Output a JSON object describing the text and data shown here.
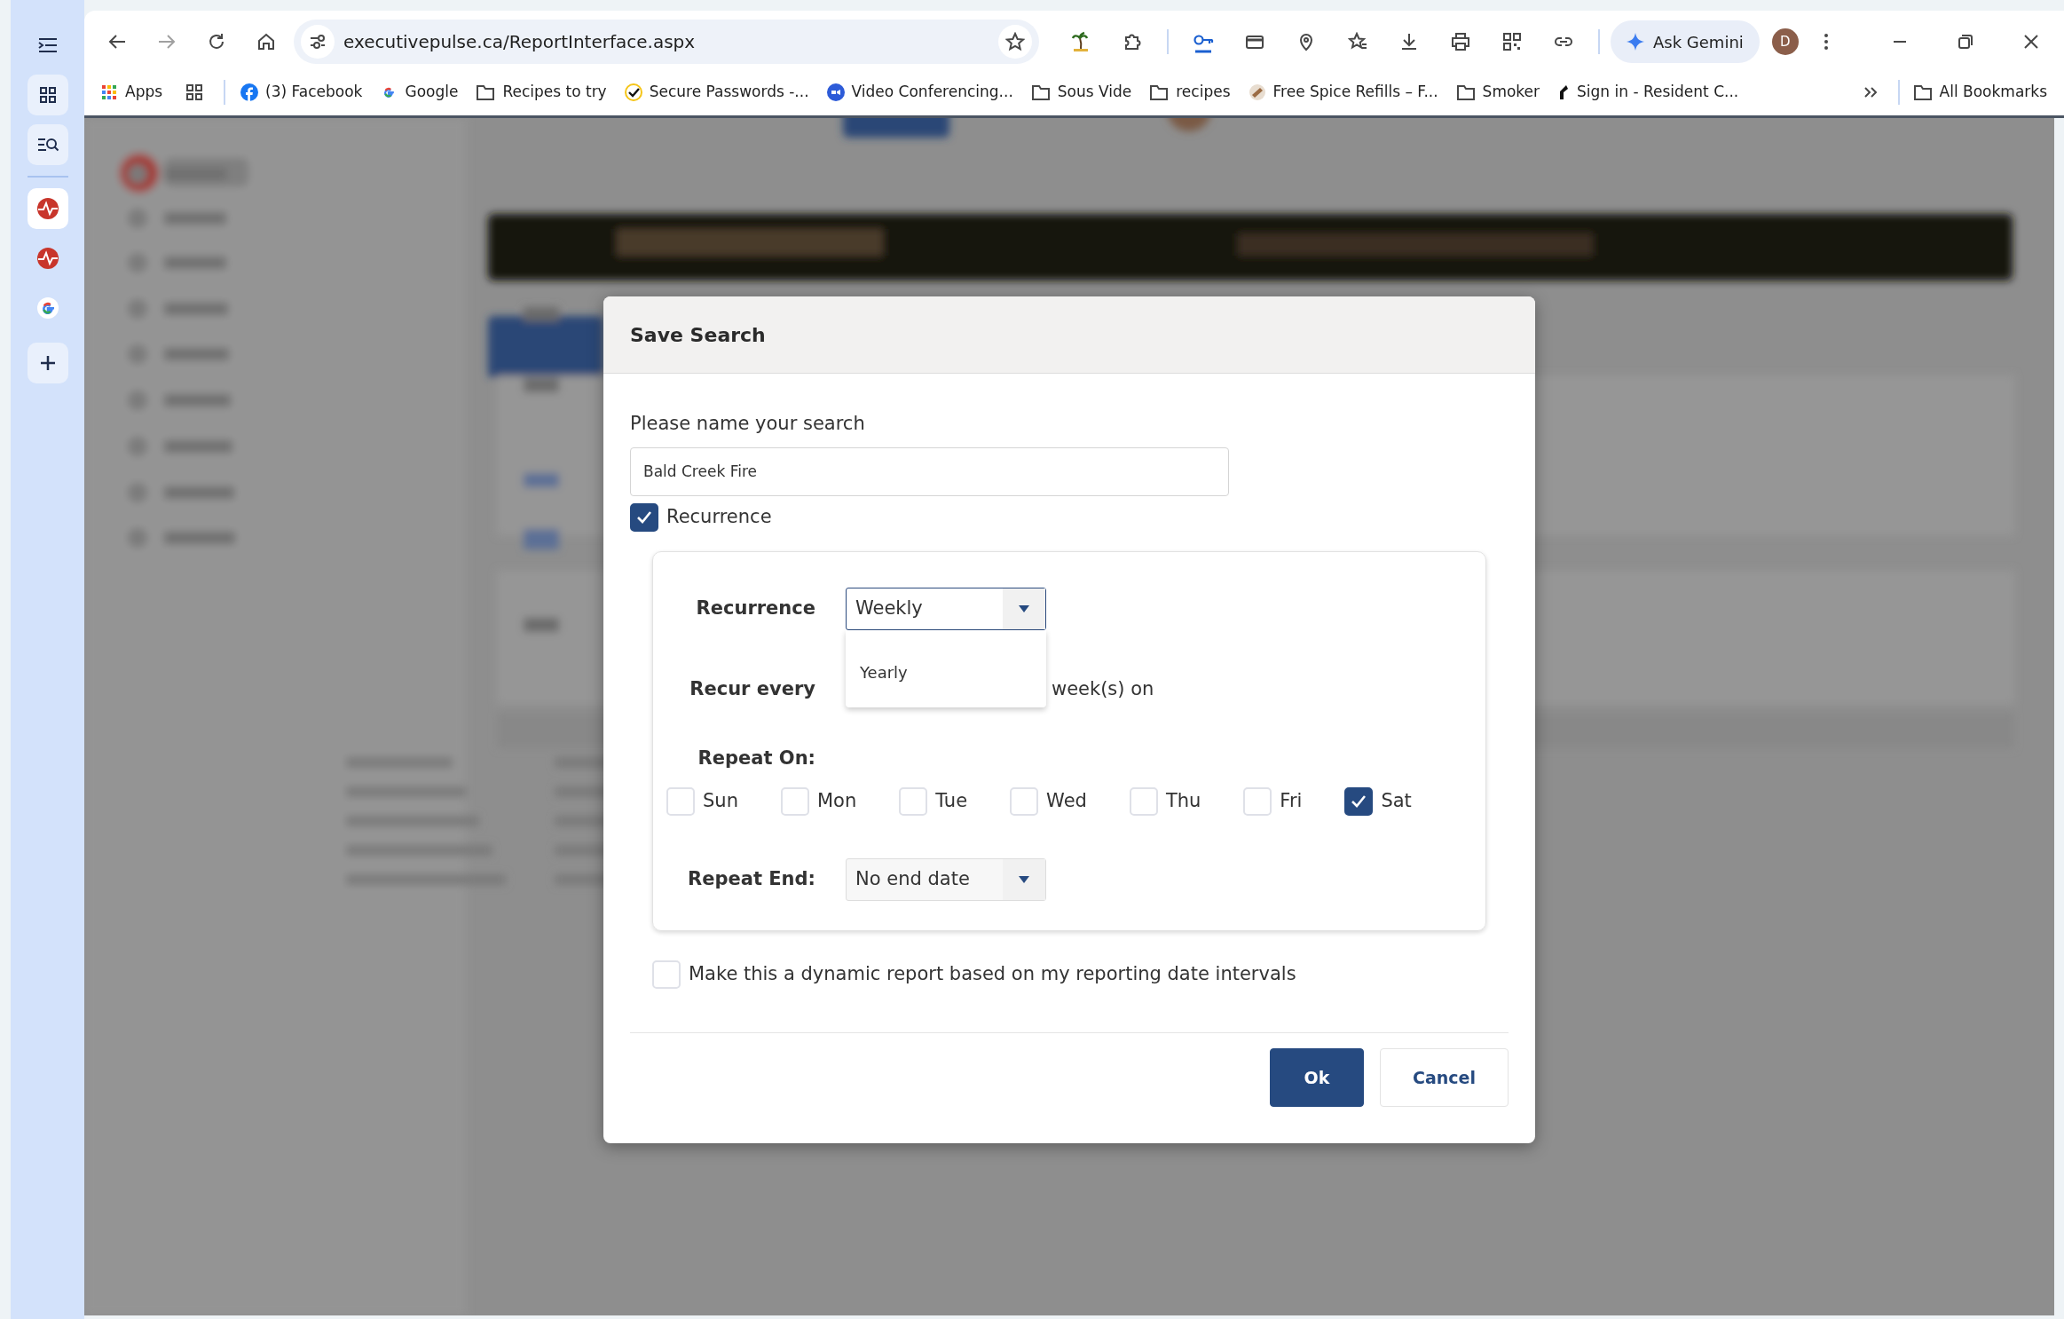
{
  "browser": {
    "url": "executivepulse.ca/ReportInterface.aspx",
    "assistant": "Ask Gemini",
    "profile": "D",
    "bookmarks": [
      {
        "label": "Apps",
        "kind": "apps"
      },
      {
        "label": "(3) Facebook",
        "kind": "facebook"
      },
      {
        "label": "Google",
        "kind": "google"
      },
      {
        "label": "Recipes to try",
        "kind": "folder"
      },
      {
        "label": "Secure Passwords -...",
        "kind": "passwords"
      },
      {
        "label": "Video Conferencing...",
        "kind": "zoom"
      },
      {
        "label": "Sous Vide",
        "kind": "folder"
      },
      {
        "label": "recipes",
        "kind": "folder"
      },
      {
        "label": "Free Spice Refills – F...",
        "kind": "spice"
      },
      {
        "label": "Smoker",
        "kind": "folder"
      },
      {
        "label": "Sign in - Resident C...",
        "kind": "resident"
      }
    ],
    "all_bookmarks": "All Bookmarks"
  },
  "dialog": {
    "title": "Save Search",
    "name_label": "Please name your search",
    "name_value": "Bald Creek Fire",
    "recurrence_toggle": {
      "label": "Recurrence",
      "checked": true
    },
    "recurrence": {
      "label": "Recurrence",
      "value": "Weekly",
      "options": [
        "Yearly"
      ]
    },
    "recur_every": {
      "label": "Recur every",
      "suffix": "week(s) on"
    },
    "repeat_on": {
      "label": "Repeat On:",
      "days": [
        {
          "label": "Sun",
          "checked": false
        },
        {
          "label": "Mon",
          "checked": false
        },
        {
          "label": "Tue",
          "checked": false
        },
        {
          "label": "Wed",
          "checked": false
        },
        {
          "label": "Thu",
          "checked": false
        },
        {
          "label": "Fri",
          "checked": false
        },
        {
          "label": "Sat",
          "checked": true
        }
      ]
    },
    "repeat_end": {
      "label": "Repeat End:",
      "value": "No end date"
    },
    "dynamic": {
      "label": "Make this a dynamic report based on my reporting date intervals",
      "checked": false
    },
    "buttons": [
      {
        "label": "Ok",
        "kind": "primary"
      },
      {
        "label": "Cancel",
        "kind": "secondary"
      }
    ]
  }
}
